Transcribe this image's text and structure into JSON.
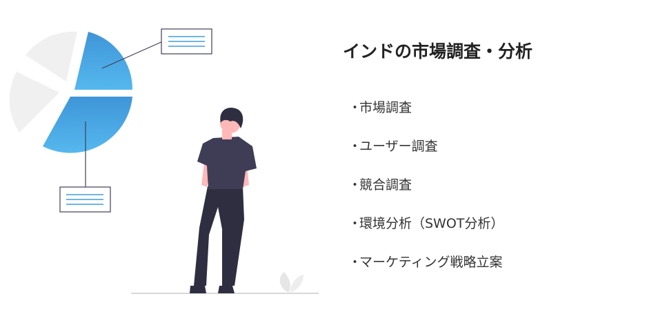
{
  "title": "インドの市場調査・分析",
  "bullet_glyph": "・",
  "items": [
    "市場調査",
    "ユーザー調査",
    "競合調査",
    "環境分析（SWOT分析）",
    "マーケティング戦略立案"
  ],
  "colors": {
    "accent_blue": "#3d9de0",
    "pie_gray": "#f0f0f0",
    "figure_shirt": "#3f3d56",
    "figure_pants": "#2f2e41",
    "skin": "#ffb8b8"
  }
}
